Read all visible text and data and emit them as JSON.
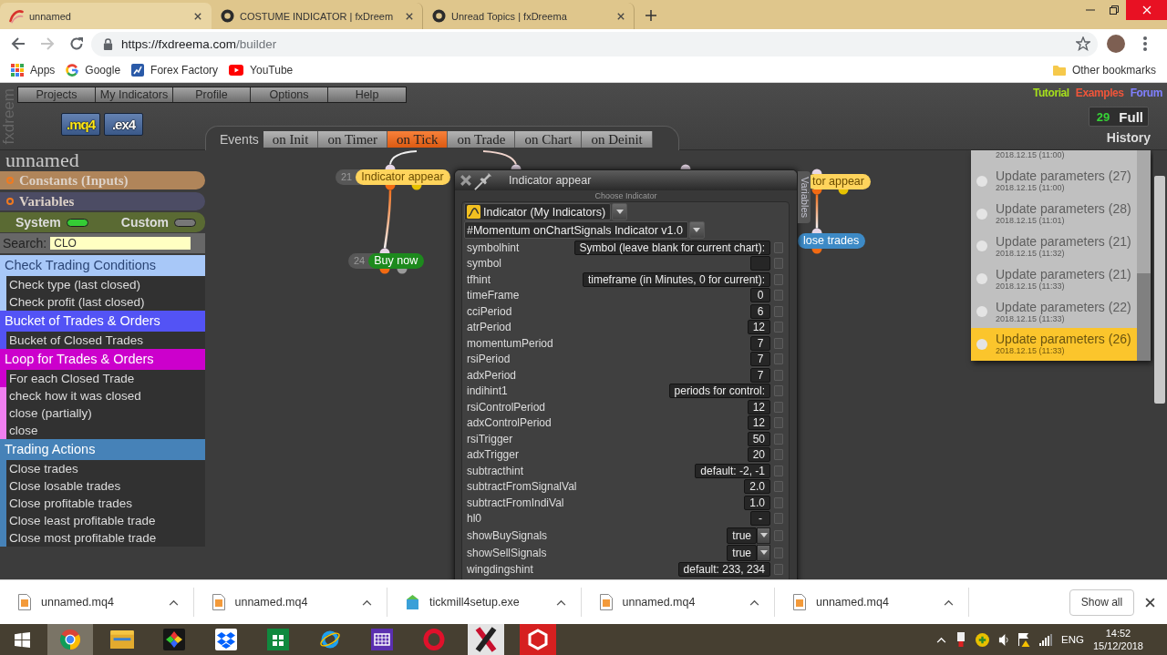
{
  "browser": {
    "tabs": [
      {
        "kind": "builder",
        "title": "unnamed",
        "selected": true
      },
      {
        "kind": "forum",
        "title": "COSTUME INDICATOR | fxDreem",
        "selected": false
      },
      {
        "kind": "forum",
        "title": "Unread Topics | fxDreema",
        "selected": false
      }
    ],
    "url": {
      "host": "https://fxdreema.com",
      "path": "/builder"
    },
    "bookmarks": [
      {
        "kind": "apps",
        "label": "Apps"
      },
      {
        "kind": "search",
        "label": "Google"
      },
      {
        "kind": "site",
        "label": "Forex Factory"
      },
      {
        "kind": "video",
        "label": "YouTube"
      }
    ],
    "other_bookmarks": "Other bookmarks"
  },
  "app": {
    "logo": "fxdreem",
    "menu": [
      "Projects",
      "My Indicators",
      "Profile",
      "Options",
      "Help"
    ],
    "export_buttons": [
      {
        "label": ".mq4",
        "selected": true
      },
      {
        "label": ".ex4",
        "selected": false
      }
    ],
    "events": {
      "label": "Events",
      "tabs": [
        {
          "label": "on Init",
          "selected": false
        },
        {
          "label": "on Timer",
          "selected": false
        },
        {
          "label": "on Tick",
          "selected": true
        },
        {
          "label": "on Trade",
          "selected": false
        },
        {
          "label": "on Chart",
          "selected": false
        },
        {
          "label": "on Deinit",
          "selected": false
        }
      ]
    },
    "top_links": [
      {
        "label": "Tutorial",
        "color": "#a6e01c"
      },
      {
        "label": "Examples",
        "color": "#f0553a"
      },
      {
        "label": "Forum",
        "color": "#8080ff"
      }
    ],
    "counter": {
      "count": "29",
      "label": "Full"
    },
    "history_label": "History",
    "project_name": "unnamed",
    "sections": [
      {
        "label": "Constants (Inputs)",
        "color": "#b0855a"
      },
      {
        "label": "Variables",
        "color": "#4c4c64"
      }
    ],
    "toggles": [
      {
        "label": "System",
        "on": true
      },
      {
        "label": "Custom",
        "on": false
      }
    ],
    "search": {
      "label": "Search:",
      "value": "CLO"
    },
    "categories": [
      {
        "title": "Check Trading Conditions",
        "color": "#a8c8f8",
        "items": [
          {
            "label": "Check type (last closed)"
          },
          {
            "label": "Check profit (last closed)"
          }
        ]
      },
      {
        "title": "Bucket of Trades & Orders",
        "color": "#5353f5",
        "items": [
          {
            "label": "Bucket of Closed Trades"
          }
        ]
      },
      {
        "title": "Loop for Trades & Orders",
        "color": "#cc00cc",
        "items": [
          {
            "label": "For each Closed Trade"
          },
          {
            "label": "check how it was closed",
            "color": "#f07ff0"
          },
          {
            "label": "close (partially)",
            "color": "#f07ff0"
          },
          {
            "label": "close",
            "color": "#f07ff0"
          }
        ]
      },
      {
        "title": "Trading Actions",
        "color": "#4682b8",
        "items": [
          {
            "label": "Close trades"
          },
          {
            "label": "Close losable trades"
          },
          {
            "label": "Close profitable trades"
          },
          {
            "label": "Close least profitable trade"
          },
          {
            "label": "Close most profitable trade"
          }
        ]
      }
    ],
    "nodes": [
      {
        "number": "21",
        "label": "Indicator appear",
        "color": "#ffd45c"
      },
      {
        "number": "24",
        "label": "Buy now",
        "color": "#1d8a1d"
      },
      {
        "label": "tor appear",
        "color": "#ffd45c"
      },
      {
        "label": "lose trades",
        "color": "#3d8ac6"
      }
    ],
    "dialog": {
      "title": "Indicator appear",
      "caption": "Choose Indicator",
      "type_select": "Indicator (My Indicators)",
      "indicator_select": "#Momentum onChartSignals Indicator v1.0",
      "side_tab": "Variables",
      "params": [
        {
          "name": "symbolhint",
          "kind": "input",
          "value": "Symbol (leave blank for current chart):",
          "checked": false
        },
        {
          "name": "symbol",
          "kind": "input",
          "checked": false
        },
        {
          "name": "tfhint",
          "kind": "input",
          "value": "timeframe (in Minutes, 0 for current):",
          "checked": false
        },
        {
          "name": "timeFrame",
          "kind": "input",
          "value": "0",
          "checked": false
        },
        {
          "name": "cciPeriod",
          "kind": "input",
          "value": "6",
          "checked": false
        },
        {
          "name": "atrPeriod",
          "kind": "input",
          "value": "12",
          "checked": false
        },
        {
          "name": "momentumPeriod",
          "kind": "input",
          "value": "7",
          "checked": false
        },
        {
          "name": "rsiPeriod",
          "kind": "input",
          "value": "7",
          "checked": false
        },
        {
          "name": "adxPeriod",
          "kind": "input",
          "value": "7",
          "checked": false
        },
        {
          "name": "indihint1",
          "kind": "input",
          "value": "periods for control:",
          "checked": false
        },
        {
          "name": "rsiControlPeriod",
          "kind": "input",
          "value": "12",
          "checked": false
        },
        {
          "name": "adxControlPeriod",
          "kind": "input",
          "value": "12",
          "checked": false
        },
        {
          "name": "rsiTrigger",
          "kind": "input",
          "value": "50",
          "checked": false
        },
        {
          "name": "adxTrigger",
          "kind": "input",
          "value": "20",
          "checked": false
        },
        {
          "name": "subtracthint",
          "kind": "input",
          "value": "default: -2, -1",
          "checked": false
        },
        {
          "name": "subtractFromSignalVal",
          "kind": "input",
          "value": "2.0",
          "checked": false
        },
        {
          "name": "subtractFromIndiVal",
          "kind": "input",
          "value": "1.0",
          "checked": false
        },
        {
          "name": "hl0",
          "kind": "input",
          "value": "-",
          "checked": false
        },
        {
          "name": "showBuySignals",
          "kind": "select",
          "value": "true",
          "checked": false
        },
        {
          "name": "showSellSignals",
          "kind": "select",
          "value": "true",
          "checked": false
        },
        {
          "name": "wingdingshint",
          "kind": "input",
          "value": "default: 233, 234",
          "checked": false
        }
      ]
    },
    "history": {
      "items": [
        {
          "date": "2018.12.15 (11:00)",
          "selected": false
        },
        {
          "title": "Update parameters (27)",
          "date": "2018.12.15 (11:00)",
          "selected": false
        },
        {
          "title": "Update parameters (28)",
          "date": "2018.12.15 (11:01)",
          "selected": false
        },
        {
          "title": "Update parameters (21)",
          "date": "2018.12.15 (11:32)",
          "selected": false
        },
        {
          "title": "Update parameters (21)",
          "date": "2018.12.15 (11:33)",
          "selected": false
        },
        {
          "title": "Update parameters (22)",
          "date": "2018.12.15 (11:33)",
          "selected": false
        },
        {
          "title": "Update parameters (26)",
          "date": "2018.12.15 (11:33)",
          "selected": true
        }
      ]
    }
  },
  "downloads": {
    "items": [
      {
        "kind": "document",
        "name": "unnamed.mq4"
      },
      {
        "kind": "document",
        "name": "unnamed.mq4"
      },
      {
        "kind": "installer",
        "name": "tickmill4setup.exe"
      },
      {
        "kind": "document",
        "name": "unnamed.mq4"
      },
      {
        "kind": "document",
        "name": "unnamed.mq4"
      }
    ],
    "show_all": "Show all"
  },
  "taskbar": {
    "apps": [
      {
        "kind": "browser",
        "selected": true
      },
      {
        "kind": "files",
        "selected": false
      },
      {
        "kind": "mosaic",
        "selected": false
      },
      {
        "kind": "storage",
        "selected": false
      },
      {
        "kind": "store",
        "selected": false
      },
      {
        "kind": "web",
        "selected": false
      },
      {
        "kind": "keypad",
        "selected": false
      },
      {
        "kind": "ring",
        "selected": false
      },
      {
        "kind": "cross",
        "selected": false
      },
      {
        "kind": "hexagon",
        "selected": false
      }
    ],
    "language": "ENG",
    "time": "14:52",
    "date": "15/12/2018"
  }
}
